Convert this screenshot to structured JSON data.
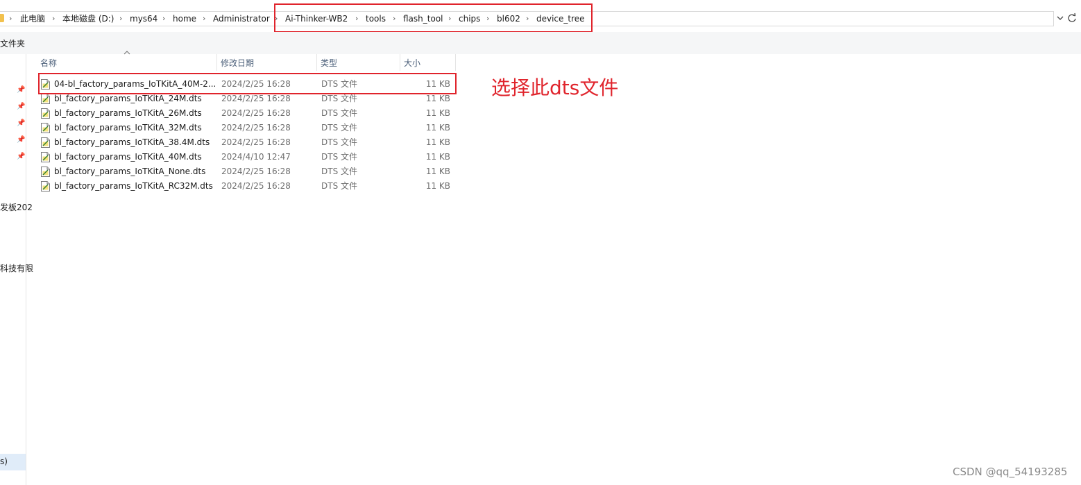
{
  "address": {
    "crumbs": [
      "此电脑",
      "本地磁盘 (D:)",
      "mys64",
      "home",
      "Administrator",
      "Ai-Thinker-WB2",
      "tools",
      "flash_tool",
      "chips",
      "bl602",
      "device_tree"
    ],
    "separator": "›",
    "dropdown_icon": "chevron-down-icon",
    "refresh_icon": "refresh-icon"
  },
  "toolbar": {
    "label": "文件夹"
  },
  "nav": {
    "pinned_count": 5,
    "items": [
      "发板202",
      "科技有限",
      "s)"
    ]
  },
  "columns": {
    "name": "名称",
    "date": "修改日期",
    "type": "类型",
    "size": "大小"
  },
  "files": [
    {
      "name": "04-bl_factory_params_IoTKitA_40M-2...",
      "date": "2024/2/25 16:28",
      "type": "DTS 文件",
      "size": "11 KB"
    },
    {
      "name": "bl_factory_params_IoTKitA_24M.dts",
      "date": "2024/2/25 16:28",
      "type": "DTS 文件",
      "size": "11 KB"
    },
    {
      "name": "bl_factory_params_IoTKitA_26M.dts",
      "date": "2024/2/25 16:28",
      "type": "DTS 文件",
      "size": "11 KB"
    },
    {
      "name": "bl_factory_params_IoTKitA_32M.dts",
      "date": "2024/2/25 16:28",
      "type": "DTS 文件",
      "size": "11 KB"
    },
    {
      "name": "bl_factory_params_IoTKitA_38.4M.dts",
      "date": "2024/2/25 16:28",
      "type": "DTS 文件",
      "size": "11 KB"
    },
    {
      "name": "bl_factory_params_IoTKitA_40M.dts",
      "date": "2024/4/10 12:47",
      "type": "DTS 文件",
      "size": "11 KB"
    },
    {
      "name": "bl_factory_params_IoTKitA_None.dts",
      "date": "2024/2/25 16:28",
      "type": "DTS 文件",
      "size": "11 KB"
    },
    {
      "name": "bl_factory_params_IoTKitA_RC32M.dts",
      "date": "2024/2/25 16:28",
      "type": "DTS 文件",
      "size": "11 KB"
    }
  ],
  "annotation": "选择此dts文件",
  "watermark": "CSDN @qq_54193285",
  "colors": {
    "highlight": "#e0242c",
    "header_text": "#4c607a",
    "toolbar_bg": "#f5f6f7"
  }
}
